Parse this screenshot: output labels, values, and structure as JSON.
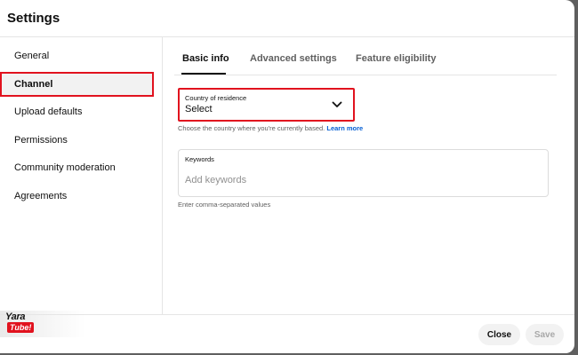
{
  "dialog": {
    "title": "Settings"
  },
  "sidebar": {
    "items": [
      {
        "label": "General"
      },
      {
        "label": "Channel"
      },
      {
        "label": "Upload defaults"
      },
      {
        "label": "Permissions"
      },
      {
        "label": "Community moderation"
      },
      {
        "label": "Agreements"
      }
    ],
    "selected": "Channel"
  },
  "tabs": [
    {
      "label": "Basic info"
    },
    {
      "label": "Advanced settings"
    },
    {
      "label": "Feature eligibility"
    }
  ],
  "basic_info": {
    "country": {
      "label": "Country of residence",
      "value": "Select",
      "help": "Choose the country where you're currently based.",
      "learn_more": "Learn more"
    },
    "keywords": {
      "label": "Keywords",
      "placeholder": "Add keywords",
      "value": "",
      "help": "Enter comma-separated values"
    }
  },
  "footer": {
    "close_label": "Close",
    "save_label": "Save"
  },
  "watermark": {
    "line1": "Yara",
    "line2": "Tube!"
  },
  "colors": {
    "highlight": "#e1121e",
    "link": "#065fd4",
    "text": "#0f0f0f",
    "secondary": "#606060"
  }
}
